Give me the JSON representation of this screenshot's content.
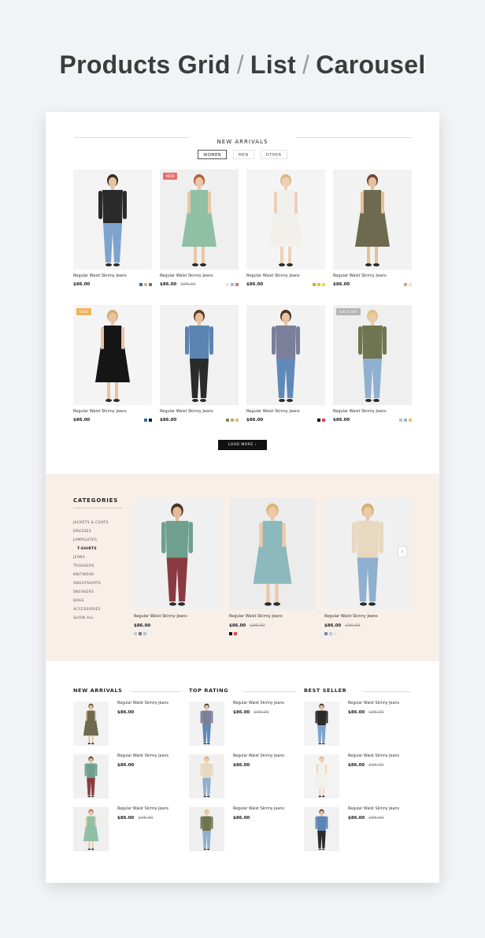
{
  "headline": {
    "part1": "Products Grid",
    "sep": "/",
    "part2": "List",
    "part3": "Carousel"
  },
  "new_arrivals": {
    "title": "NEW ARRIVALS",
    "tabs": [
      "WOMEN",
      "MEN",
      "OTHER"
    ],
    "active_tab": "WOMEN",
    "products": [
      {
        "name": "Regular Waist Skinny Jeans",
        "price": "$86.00",
        "old_price": "",
        "badge": "",
        "swatches": [
          "#4d6a8f",
          "#c9b89a",
          "#6e7b5a"
        ]
      },
      {
        "name": "Regular Waist Skinny Jeans",
        "price": "$86.00",
        "old_price": "$96.00",
        "badge": "NEW",
        "swatches": [
          "#e6e6e6",
          "#b9b9b9",
          "#e07a6b"
        ]
      },
      {
        "name": "Regular Waist Skinny Jeans",
        "price": "$86.00",
        "old_price": "",
        "badge": "",
        "swatches": [
          "#d9a32e",
          "#e0c04b",
          "#f0d15c"
        ]
      },
      {
        "name": "Regular Waist Skinny Jeans",
        "price": "$86.00",
        "old_price": "",
        "badge": "",
        "swatches": [
          "#d6a470",
          "#f0e0d0"
        ]
      },
      {
        "name": "Regular Waist Skinny Jeans",
        "price": "$86.00",
        "old_price": "",
        "badge": "SALE",
        "swatches": [
          "#2e6ea3",
          "#1c1c1c"
        ]
      },
      {
        "name": "Regular Waist Skinny Jeans",
        "price": "$86.00",
        "old_price": "",
        "badge": "",
        "swatches": [
          "#7a8f5a",
          "#c9a86b",
          "#e0c07a"
        ]
      },
      {
        "name": "Regular Waist Skinny Jeans",
        "price": "$86.00",
        "old_price": "",
        "badge": "",
        "swatches": [
          "#111111",
          "#d04a4a"
        ]
      },
      {
        "name": "Regular Waist Skinny Jeans",
        "price": "$86.00",
        "old_price": "",
        "badge": "SOLD OUT",
        "swatches": [
          "#bfbfbf",
          "#8fb4d6",
          "#e8d04a"
        ]
      }
    ],
    "load_more": "LOAD MORE"
  },
  "categories": {
    "title": "CATEGORIES",
    "items": [
      "JACKETS & COATS",
      "DRESSES",
      "JUMPSUITES",
      "T-SHIRTS",
      "JEANS",
      "TROUSERS",
      "KNITWEAR",
      "SWEATSHIRTS",
      "SNEAKERS",
      "BAGS",
      "ACCESSORIES",
      "SHOW ALL"
    ],
    "selected": "T-SHIRTS",
    "carousel": [
      {
        "name": "Regular Waist Skinny Jeans",
        "price": "$86.00",
        "old_price": "",
        "swatches": [
          "#c8c8c8",
          "#6a7f9a",
          "#a9c6da"
        ]
      },
      {
        "name": "Regular Waist Skinny Jeans",
        "price": "$86.00",
        "old_price": "$96.00",
        "swatches": [
          "#111111",
          "#d04a4a"
        ]
      },
      {
        "name": "Regular Waist Skinny Jeans",
        "price": "$86.00",
        "old_price": "$96.00",
        "swatches": [
          "#6a8fb4",
          "#b8c8d8",
          "#e8e8e8"
        ]
      }
    ]
  },
  "lists": [
    {
      "title": "NEW ARRIVALS",
      "items": [
        {
          "name": "Regular Waist Skinny Jeans",
          "price": "$86.00",
          "old_price": ""
        },
        {
          "name": "Regular Waist Skinny Jeans",
          "price": "$86.00",
          "old_price": ""
        },
        {
          "name": "Regular Waist Skinny Jeans",
          "price": "$86.00",
          "old_price": "$96.00"
        }
      ]
    },
    {
      "title": "TOP RATING",
      "items": [
        {
          "name": "Regular Waist Skinny Jeans",
          "price": "$86.00",
          "old_price": "$96.00"
        },
        {
          "name": "Regular Waist Skinny Jeans",
          "price": "$86.00",
          "old_price": ""
        },
        {
          "name": "Regular Waist Skinny Jeans",
          "price": "$86.00",
          "old_price": ""
        }
      ]
    },
    {
      "title": "BEST SELLER",
      "items": [
        {
          "name": "Regular Waist Skinny Jeans",
          "price": "$86.00",
          "old_price": "$96.00"
        },
        {
          "name": "Regular Waist Skinny Jeans",
          "price": "$86.00",
          "old_price": "$96.00"
        },
        {
          "name": "Regular Waist Skinny Jeans",
          "price": "$86.00",
          "old_price": "$96.00"
        }
      ]
    }
  ],
  "colors": {
    "badge_new": "#e86f6f",
    "badge_sale": "#f1b25a",
    "badge_soldout": "#b5b5b5",
    "category_band": "#f8efe8"
  }
}
